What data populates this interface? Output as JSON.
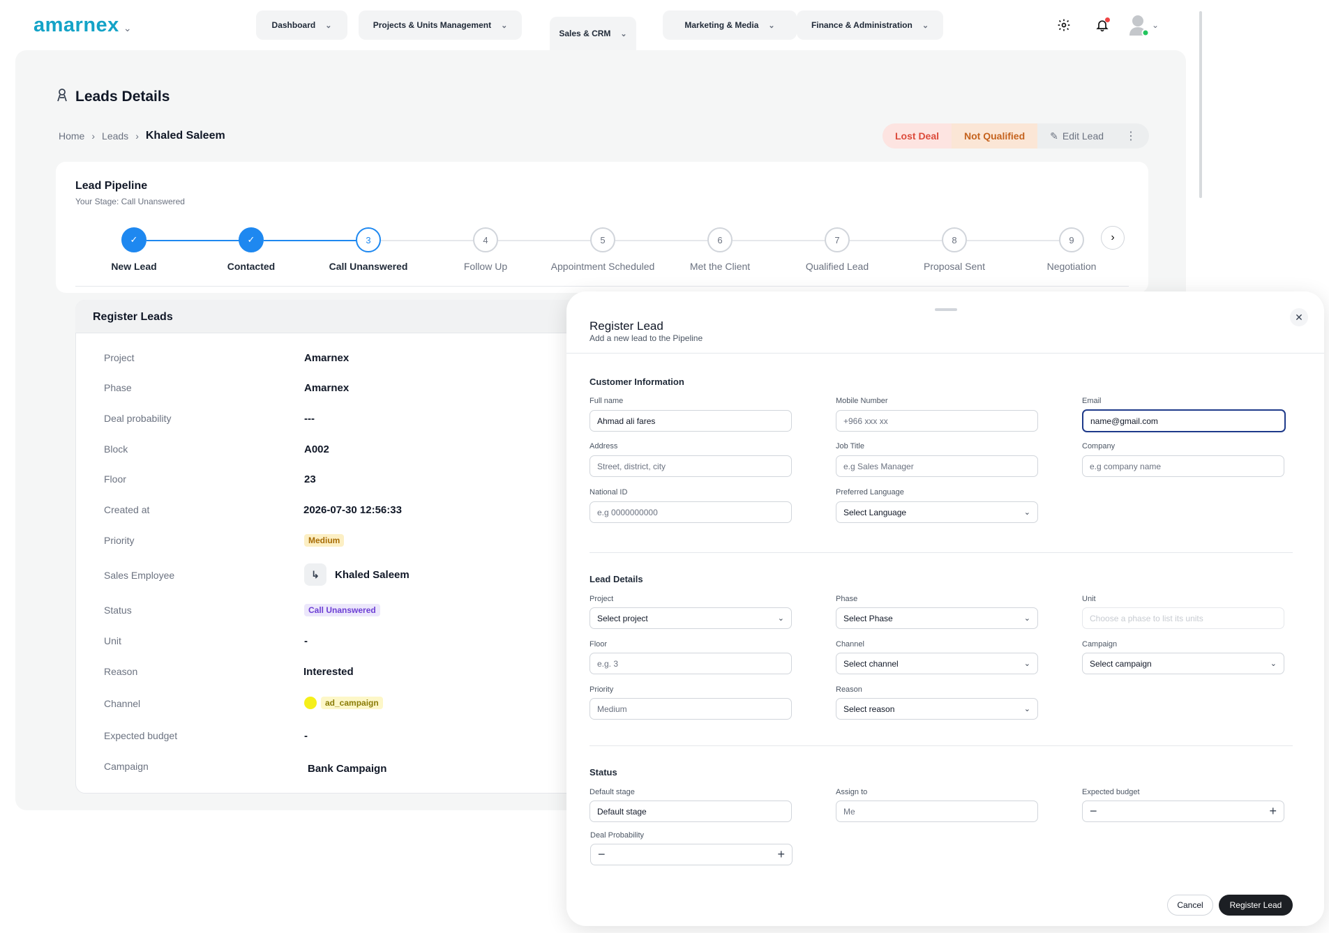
{
  "brand": {
    "logo": "amarnex",
    "accent": "#14a3c7"
  },
  "nav": {
    "items": [
      {
        "label": "Dashboard"
      },
      {
        "label": "Projects & Units Management"
      },
      {
        "label": "Sales & CRM"
      },
      {
        "label": "Marketing & Media"
      },
      {
        "label": "Finance & Administration"
      }
    ],
    "active": "Sales & CRM"
  },
  "page": {
    "title": "Leads Details",
    "breadcrumb": [
      "Home",
      "Leads",
      "Khaled Saleem"
    ],
    "actions": {
      "lost": "Lost Deal",
      "not_qualified": "Not Qualified",
      "edit": "Edit Lead"
    }
  },
  "pipeline": {
    "title": "Lead Pipeline",
    "subtitle": "Your Stage: Call Unanswered",
    "steps": [
      {
        "n": "1",
        "label": "New Lead",
        "state": "done"
      },
      {
        "n": "2",
        "label": "Contacted",
        "state": "done"
      },
      {
        "n": "3",
        "label": "Call Unanswered",
        "state": "current"
      },
      {
        "n": "4",
        "label": "Follow Up",
        "state": "todo"
      },
      {
        "n": "5",
        "label": "Appointment Scheduled",
        "state": "todo"
      },
      {
        "n": "6",
        "label": "Met the Client",
        "state": "todo"
      },
      {
        "n": "7",
        "label": "Qualified Lead",
        "state": "todo"
      },
      {
        "n": "8",
        "label": "Proposal Sent",
        "state": "todo"
      },
      {
        "n": "9",
        "label": "Negotiation",
        "state": "todo"
      }
    ]
  },
  "register_leads": {
    "title": "Register Leads",
    "rows": [
      {
        "label": "Project",
        "value": "Amarnex"
      },
      {
        "label": "Phase",
        "value": "Amarnex"
      },
      {
        "label": "Deal probability",
        "value": "---"
      },
      {
        "label": "Block",
        "value": "A002"
      },
      {
        "label": "Floor",
        "value": "23"
      },
      {
        "label": "Created at",
        "value": "2026-07-30 12:56:33"
      },
      {
        "label": "Priority",
        "value": "Medium"
      },
      {
        "label": "Sales Employee",
        "value": "Khaled Saleem"
      },
      {
        "label": "Status",
        "value": "Call Unanswered"
      },
      {
        "label": "Unit",
        "value": "-"
      },
      {
        "label": "Reason",
        "value": "Interested"
      },
      {
        "label": "Channel",
        "value": "ad_campaign"
      },
      {
        "label": "Expected budget",
        "value": "-"
      },
      {
        "label": "Campaign",
        "value": "Bank Campaign"
      }
    ]
  },
  "modal": {
    "title": "Register Lead",
    "subtitle": "Add a new lead to the Pipeline",
    "sections": {
      "customer": "Customer Information",
      "lead": "Lead Details",
      "status": "Status"
    },
    "fields": {
      "full_name": {
        "label": "Full name",
        "value": "Ahmad ali fares"
      },
      "mobile": {
        "label": "Mobile Number",
        "placeholder": "+966 xxx xx"
      },
      "email": {
        "label": "Email",
        "value": "name@gmail.com"
      },
      "address": {
        "label": "Address",
        "placeholder": "Street, district, city"
      },
      "job_title": {
        "label": "Job Title",
        "placeholder": "e.g Sales Manager"
      },
      "company": {
        "label": "Company",
        "placeholder": "e.g company name"
      },
      "national_id": {
        "label": "National ID",
        "placeholder": "e.g 0000000000"
      },
      "language": {
        "label": "Preferred Language",
        "value": "Select Language"
      },
      "project": {
        "label": "Project",
        "value": "Select project"
      },
      "phase": {
        "label": "Phase",
        "value": "Select Phase"
      },
      "unit": {
        "label": "Unit",
        "placeholder": "Choose a phase to list its units"
      },
      "floor": {
        "label": "Floor",
        "placeholder": "e.g. 3"
      },
      "channel": {
        "label": "Channel",
        "value": "Select channel"
      },
      "campaign": {
        "label": "Campaign",
        "value": "Select campaign"
      },
      "priority": {
        "label": "Priority",
        "placeholder": "Medium"
      },
      "reason": {
        "label": "Reason",
        "value": "Select reason"
      },
      "default_stage": {
        "label": "Default stage",
        "value": "Default stage"
      },
      "assign_to": {
        "label": "Assign to",
        "placeholder": "Me"
      },
      "expected_budget": {
        "label": "Expected budget"
      },
      "deal_probability": {
        "label": "Deal Probability"
      }
    },
    "buttons": {
      "cancel": "Cancel",
      "register": "Register Lead"
    }
  },
  "colors": {
    "primary": "#1e88f0",
    "danger": "#dc4b3b",
    "warning": "#c5631e"
  }
}
